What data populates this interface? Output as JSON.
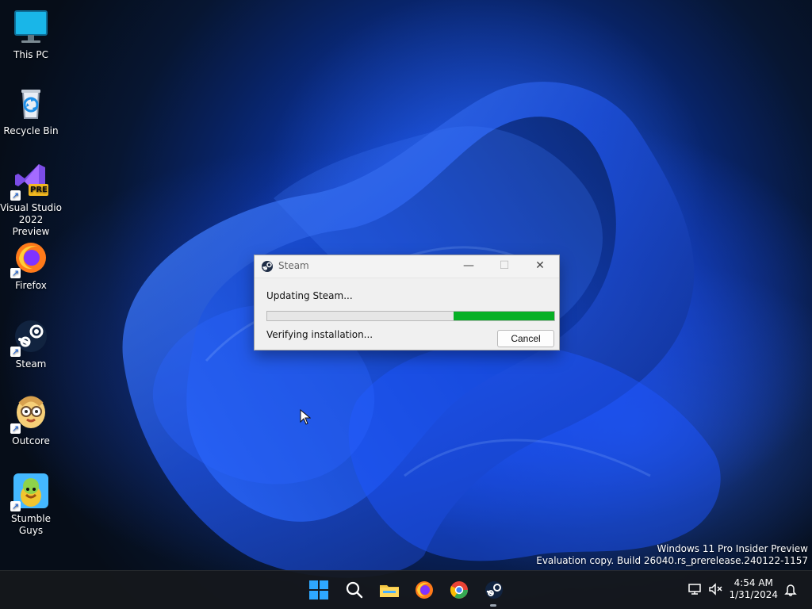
{
  "desktop": {
    "icons": [
      {
        "label": "This PC"
      },
      {
        "label": "Recycle Bin"
      },
      {
        "label_line1": "Visual Studio",
        "label_line2": "2022 Preview",
        "badge": "PRE"
      },
      {
        "label": "Firefox"
      },
      {
        "label": "Steam"
      },
      {
        "label": "Outcore"
      },
      {
        "label": "Stumble Guys"
      }
    ]
  },
  "dialog": {
    "title": "Steam",
    "updating": "Updating Steam...",
    "verifying": "Verifying installation...",
    "cancel": "Cancel",
    "progress_fraction": 0.35
  },
  "watermark": {
    "line1": "Windows 11 Pro Insider Preview",
    "line2": "Evaluation copy. Build 26040.rs_prerelease.240122-1157"
  },
  "taskbar": {
    "time": "4:54 AM",
    "date": "1/31/2024"
  },
  "icons": {
    "this_pc": "monitor-icon",
    "recycle_bin": "recycle-bin-icon",
    "visual_studio": "visual-studio-icon",
    "firefox": "firefox-icon",
    "steam": "steam-icon",
    "outcore": "outcore-icon",
    "stumble_guys": "stumble-guys-icon",
    "start": "windows-start-icon",
    "search": "search-icon",
    "file_explorer": "folder-icon",
    "chrome": "chrome-icon",
    "network": "network-icon",
    "volume": "volume-muted-icon",
    "notifications": "bell-icon"
  },
  "colors": {
    "progress_fill": "#06b025",
    "dialog_bg": "#f0f0f0",
    "taskbar_bg": "#16181c"
  }
}
